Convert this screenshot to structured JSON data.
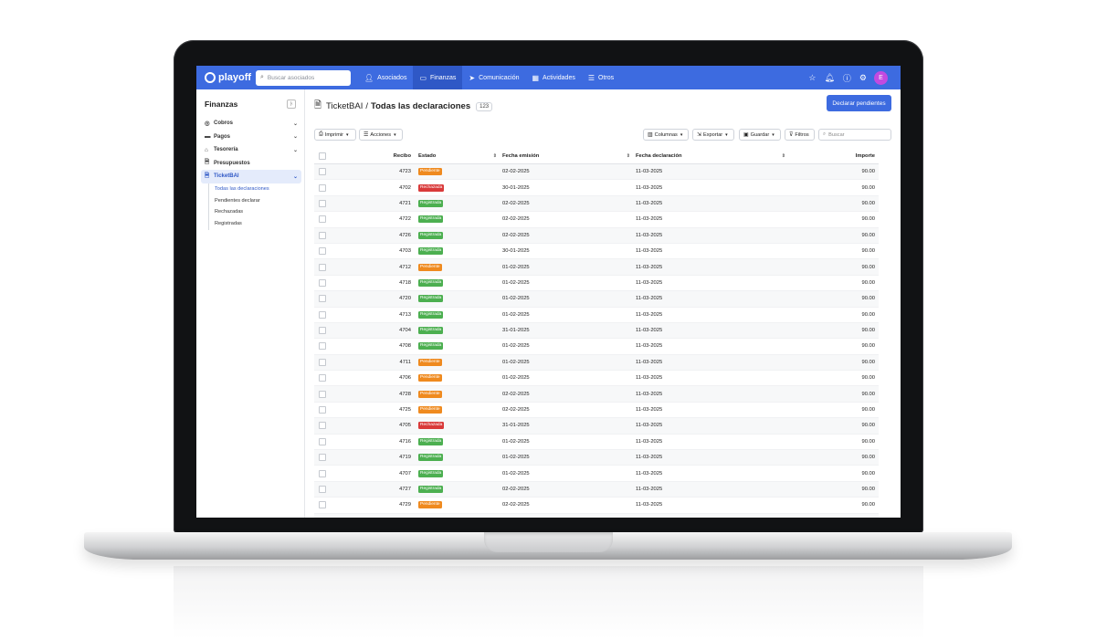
{
  "app": {
    "logo_text": "playoff",
    "search_placeholder": "Buscar asociados",
    "avatar_letter": "E",
    "nav": [
      {
        "label": "Asociados",
        "icon": "users-icon",
        "active": false
      },
      {
        "label": "Finanzas",
        "icon": "wallet-icon",
        "active": true
      },
      {
        "label": "Comunicación",
        "icon": "send-icon",
        "active": false
      },
      {
        "label": "Actividades",
        "icon": "calendar-icon",
        "active": false
      },
      {
        "label": "Otros",
        "icon": "list-icon",
        "active": false
      }
    ]
  },
  "sidebar": {
    "title": "Finanzas",
    "items": [
      {
        "label": "Cobros",
        "icon": "coins-icon",
        "has_chevron": true
      },
      {
        "label": "Pagos",
        "icon": "card-icon",
        "has_chevron": true
      },
      {
        "label": "Tesorería",
        "icon": "piggy-icon",
        "has_chevron": true
      },
      {
        "label": "Presupuestos",
        "icon": "document-icon",
        "has_chevron": false
      },
      {
        "label": "TicketBAI",
        "icon": "document-icon",
        "has_chevron": true,
        "active": true
      }
    ],
    "subitems": [
      {
        "label": "Todas las declaraciones",
        "active": true
      },
      {
        "label": "Pendientes declarar"
      },
      {
        "label": "Rechazadas"
      },
      {
        "label": "Registradas"
      }
    ]
  },
  "page": {
    "crumb": "TicketBAI",
    "separator": "/",
    "title": "Todas las declaraciones",
    "count": "123",
    "primary_button": "Declarar pendientes"
  },
  "toolbar": {
    "imprimir": "Imprimir",
    "acciones": "Acciones",
    "columnas": "Columnas",
    "exportar": "Exportar",
    "guardar": "Guardar",
    "filtros": "Filtros",
    "search_placeholder": "Buscar"
  },
  "table": {
    "headers": {
      "recibo": "Recibo",
      "estado": "Estado",
      "fecha_emision": "Fecha emisión",
      "fecha_declaracion": "Fecha declaración",
      "importe": "Importe"
    },
    "status_colors": {
      "Pendiente": "#ef8a1f",
      "Rechazada": "#d93a3a",
      "Registrada": "#4caf50"
    },
    "rows": [
      {
        "recibo": "4723",
        "estado": "Pendiente",
        "emision": "02-02-2025",
        "declaracion": "11-03-2025",
        "importe": "90.00"
      },
      {
        "recibo": "4702",
        "estado": "Rechazada",
        "emision": "30-01-2025",
        "declaracion": "11-03-2025",
        "importe": "90.00"
      },
      {
        "recibo": "4721",
        "estado": "Registrada",
        "emision": "02-02-2025",
        "declaracion": "11-03-2025",
        "importe": "90.00"
      },
      {
        "recibo": "4722",
        "estado": "Registrada",
        "emision": "02-02-2025",
        "declaracion": "11-03-2025",
        "importe": "90.00"
      },
      {
        "recibo": "4726",
        "estado": "Registrada",
        "emision": "02-02-2025",
        "declaracion": "11-03-2025",
        "importe": "90.00"
      },
      {
        "recibo": "4703",
        "estado": "Registrada",
        "emision": "30-01-2025",
        "declaracion": "11-03-2025",
        "importe": "90.00"
      },
      {
        "recibo": "4712",
        "estado": "Pendiente",
        "emision": "01-02-2025",
        "declaracion": "11-03-2025",
        "importe": "90.00"
      },
      {
        "recibo": "4718",
        "estado": "Registrada",
        "emision": "01-02-2025",
        "declaracion": "11-03-2025",
        "importe": "90.00"
      },
      {
        "recibo": "4720",
        "estado": "Registrada",
        "emision": "01-02-2025",
        "declaracion": "11-03-2025",
        "importe": "90.00"
      },
      {
        "recibo": "4713",
        "estado": "Registrada",
        "emision": "01-02-2025",
        "declaracion": "11-03-2025",
        "importe": "90.00"
      },
      {
        "recibo": "4704",
        "estado": "Registrada",
        "emision": "31-01-2025",
        "declaracion": "11-03-2025",
        "importe": "90.00"
      },
      {
        "recibo": "4708",
        "estado": "Registrada",
        "emision": "01-02-2025",
        "declaracion": "11-03-2025",
        "importe": "90.00"
      },
      {
        "recibo": "4711",
        "estado": "Pendiente",
        "emision": "01-02-2025",
        "declaracion": "11-03-2025",
        "importe": "90.00"
      },
      {
        "recibo": "4706",
        "estado": "Pendiente",
        "emision": "01-02-2025",
        "declaracion": "11-03-2025",
        "importe": "90.00"
      },
      {
        "recibo": "4728",
        "estado": "Pendiente",
        "emision": "02-02-2025",
        "declaracion": "11-03-2025",
        "importe": "90.00"
      },
      {
        "recibo": "4725",
        "estado": "Pendiente",
        "emision": "02-02-2025",
        "declaracion": "11-03-2025",
        "importe": "90.00"
      },
      {
        "recibo": "4705",
        "estado": "Rechazada",
        "emision": "31-01-2025",
        "declaracion": "11-03-2025",
        "importe": "90.00"
      },
      {
        "recibo": "4716",
        "estado": "Registrada",
        "emision": "01-02-2025",
        "declaracion": "11-03-2025",
        "importe": "90.00"
      },
      {
        "recibo": "4719",
        "estado": "Registrada",
        "emision": "01-02-2025",
        "declaracion": "11-03-2025",
        "importe": "90.00"
      },
      {
        "recibo": "4707",
        "estado": "Registrada",
        "emision": "01-02-2025",
        "declaracion": "11-03-2025",
        "importe": "90.00"
      },
      {
        "recibo": "4727",
        "estado": "Registrada",
        "emision": "02-02-2025",
        "declaracion": "11-03-2025",
        "importe": "90.00"
      },
      {
        "recibo": "4729",
        "estado": "Pendiente",
        "emision": "02-02-2025",
        "declaracion": "11-03-2025",
        "importe": "90.00"
      },
      {
        "recibo": "4709",
        "estado": "Pendiente",
        "emision": "01-02-2025",
        "declaracion": "11-03-2025",
        "importe": "90.00"
      }
    ]
  }
}
